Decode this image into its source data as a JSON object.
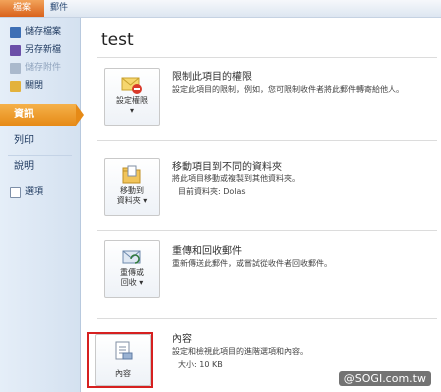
{
  "tabs": {
    "file": "檔案",
    "mail": "郵件"
  },
  "sidebar": {
    "commands": [
      {
        "label": "儲存檔案",
        "icon": "save-icon"
      },
      {
        "label": "另存新檔",
        "icon": "save-as-icon"
      },
      {
        "label": "儲存附件",
        "icon": "save-attachment-icon"
      },
      {
        "label": "關閉",
        "icon": "close-folder-icon"
      }
    ],
    "nav": {
      "info": "資訊",
      "print": "列印",
      "help": "說明",
      "options": "選項"
    }
  },
  "main": {
    "title": "test",
    "sections": [
      {
        "button_line1": "設定權限",
        "button_line2": "▾",
        "title": "限制此項目的權限",
        "desc": "設定此項目的限制，例如，您可限制收件者將此郵件轉寄給他人。"
      },
      {
        "button_line1": "移動到",
        "button_line2": "資料夾 ▾",
        "title": "移動項目到不同的資料夾",
        "desc": "將此項目移動或複製到其他資料夾。",
        "bullet": "目前資料夾:  Dolas"
      },
      {
        "button_line1": "重傳或",
        "button_line2": "回收 ▾",
        "title": "重傳和回收郵件",
        "desc": "重新傳送此郵件，或嘗試從收件者回收郵件。"
      },
      {
        "button_line1": "內容",
        "title": "內容",
        "desc": "設定和檢視此項目的進階選項和內容。",
        "bullet": "大小:  10 KB"
      }
    ]
  },
  "watermark": "@SOGI.com.tw",
  "colors": {
    "accent": "#e68a16",
    "highlight": "#d62020"
  }
}
